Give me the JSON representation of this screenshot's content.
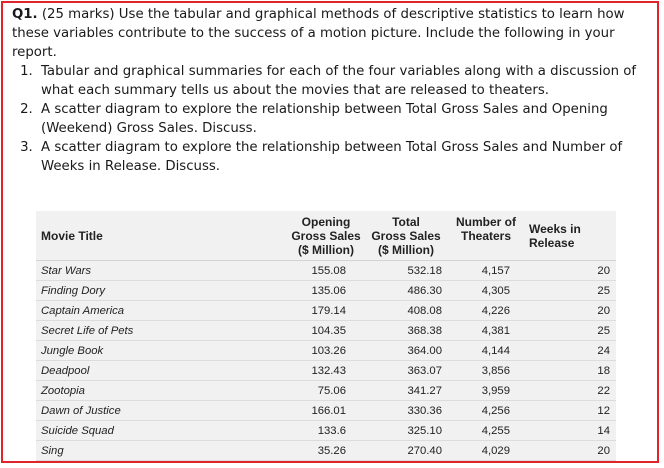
{
  "question": {
    "number": "Q1.",
    "intro": " (25 marks) Use the tabular and graphical methods of descriptive statistics to learn how these variables contribute to the success of a motion picture. Include the following in your report.",
    "items": [
      "Tabular and graphical summaries for each of the four variables along with a discussion of what each summary tells us about the movies that are released to theaters.",
      "A scatter diagram to explore the relationship between Total Gross Sales and Opening (Weekend) Gross Sales. Discuss.",
      "A scatter diagram to explore the relationship between Total Gross Sales and Number of Weeks in Release. Discuss."
    ]
  },
  "table": {
    "headers": {
      "title": "Movie Title",
      "opening_1": "Opening",
      "opening_2": "Gross Sales",
      "opening_3": "($ Million)",
      "gross_1": "Total",
      "gross_2": "Gross Sales",
      "gross_3": "($ Million)",
      "theaters_1": "Number of",
      "theaters_2": "Theaters",
      "weeks_1": "Weeks in",
      "weeks_2": "Release"
    },
    "rows": [
      {
        "title": "Star Wars",
        "opening": "155.08",
        "gross": "532.18",
        "theaters": "4,157",
        "weeks": "20"
      },
      {
        "title": "Finding Dory",
        "opening": "135.06",
        "gross": "486.30",
        "theaters": "4,305",
        "weeks": "25"
      },
      {
        "title": "Captain America",
        "opening": "179.14",
        "gross": "408.08",
        "theaters": "4,226",
        "weeks": "20"
      },
      {
        "title": "Secret Life of Pets",
        "opening": "104.35",
        "gross": "368.38",
        "theaters": "4,381",
        "weeks": "25"
      },
      {
        "title": "Jungle Book",
        "opening": "103.26",
        "gross": "364.00",
        "theaters": "4,144",
        "weeks": "24"
      },
      {
        "title": "Deadpool",
        "opening": "132.43",
        "gross": "363.07",
        "theaters": "3,856",
        "weeks": "18"
      },
      {
        "title": "Zootopia",
        "opening": "75.06",
        "gross": "341.27",
        "theaters": "3,959",
        "weeks": "22"
      },
      {
        "title": "Dawn of Justice",
        "opening": "166.01",
        "gross": "330.36",
        "theaters": "4,256",
        "weeks": "12"
      },
      {
        "title": "Suicide Squad",
        "opening": "133.6",
        "gross": "325.10",
        "theaters": "4,255",
        "weeks": "14"
      },
      {
        "title": "Sing",
        "opening": "35.26",
        "gross": "270.40",
        "theaters": "4,029",
        "weeks": "20"
      }
    ]
  }
}
